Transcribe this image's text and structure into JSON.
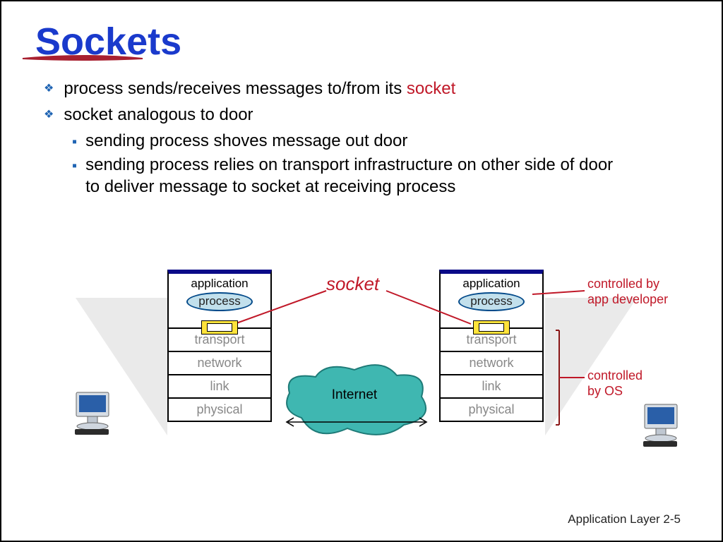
{
  "title": "Sockets",
  "bullets": {
    "b1_prefix": "process sends/receives messages to/from its ",
    "b1_socket": "socket",
    "b2": "socket analogous to door",
    "b2a": "sending process shoves message out door",
    "b2b": "sending process relies on transport infrastructure on other side of door to deliver message to socket at receiving process"
  },
  "diagram": {
    "app_label": "application",
    "process_label": "process",
    "layers": {
      "transport": "transport",
      "network": "network",
      "link": "link",
      "physical": "physical"
    },
    "socket_label": "socket",
    "internet_label": "Internet",
    "ctrl_dev_l1": "controlled by",
    "ctrl_dev_l2": "app developer",
    "ctrl_os_l1": "controlled",
    "ctrl_os_l2": "by OS"
  },
  "footer": "Application Layer 2-5"
}
